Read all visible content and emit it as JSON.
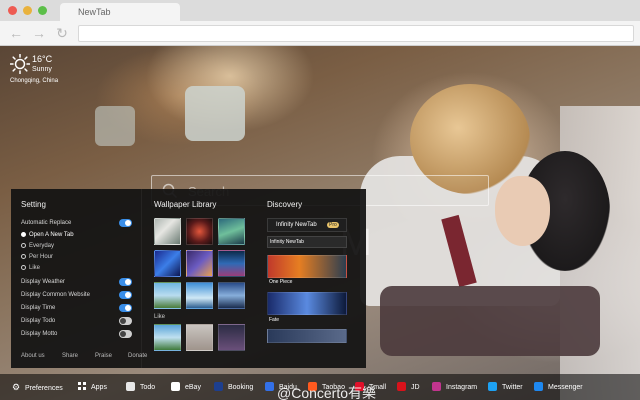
{
  "browser": {
    "tab_title": "NewTab"
  },
  "weather": {
    "temperature": "16°C",
    "condition": "Sunny",
    "location": "Chongqing, China"
  },
  "search": {
    "placeholder": "Search"
  },
  "clock": {
    "fragment": "M"
  },
  "settings": {
    "heading": "Setting",
    "auto_replace_label": "Automatic Replace",
    "auto_replace_on": true,
    "replace_options": [
      {
        "label": "Open A New Tab",
        "selected": true
      },
      {
        "label": "Everyday",
        "selected": false
      },
      {
        "label": "Per Hour",
        "selected": false
      },
      {
        "label": "Like",
        "selected": false
      }
    ],
    "toggles": [
      {
        "label": "Display Weather",
        "on": true
      },
      {
        "label": "Display Common Website",
        "on": true
      },
      {
        "label": "Display Time",
        "on": true
      },
      {
        "label": "Display Todo",
        "on": false
      },
      {
        "label": "Display Motto",
        "on": false
      }
    ],
    "footer": {
      "about": "About us",
      "share": "Share",
      "praise": "Praise",
      "donate": "Donate"
    }
  },
  "wallpaper_library": {
    "heading": "Wallpaper Library",
    "like_label": "Like"
  },
  "discovery": {
    "heading": "Discovery",
    "items": [
      {
        "label": "Infinity NewTab",
        "badge": "Pro"
      },
      {
        "label": "Infinity NewTab"
      },
      {
        "label": "One Piece"
      },
      {
        "label": "Fate"
      }
    ]
  },
  "bottom_bar": {
    "preferences": "Preferences",
    "apps": "Apps",
    "shortcuts": [
      {
        "label": "Todo",
        "color": "#e8e8e8"
      },
      {
        "label": "eBay",
        "color": "#ffffff"
      },
      {
        "label": "Booking",
        "color": "#1d3f8f"
      },
      {
        "label": "Baidu",
        "color": "#3370e8"
      },
      {
        "label": "Taobao",
        "color": "#ff5a1f"
      },
      {
        "label": "Tmall",
        "color": "#e0102a"
      },
      {
        "label": "JD",
        "color": "#d8121b"
      },
      {
        "label": "Instagram",
        "color": "#c2358e"
      },
      {
        "label": "Twitter",
        "color": "#1da1f2"
      },
      {
        "label": "Messenger",
        "color": "#1e88f0"
      }
    ]
  },
  "watermark": "@Concerto有樂"
}
